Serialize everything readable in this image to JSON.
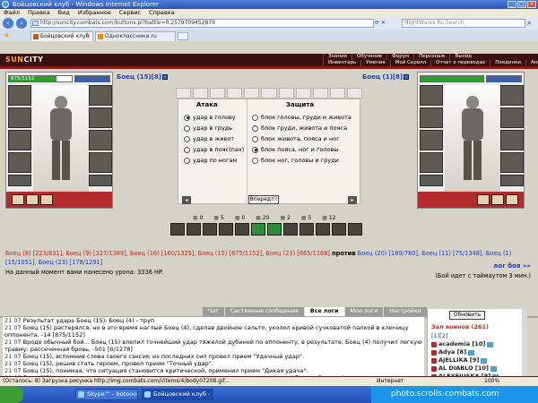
{
  "window": {
    "title": "Бойцовский клуб - Windows Internet Explorer",
    "controls": [
      "_",
      "□",
      "×"
    ]
  },
  "menu": [
    "Файл",
    "Правка",
    "Вид",
    "Избранное",
    "Сервис",
    "Справка"
  ],
  "address": {
    "url": "http://suncity.combats.com/buttons.pl?battle=0.2579709452879",
    "search": "NightWares.Ru.Search"
  },
  "tabs": [
    {
      "label": "Бойцовский клуб",
      "active": true
    },
    {
      "label": "Одноклассники.ru",
      "active": false
    }
  ],
  "game": {
    "logo_a": "SUN",
    "logo_b": "CITY",
    "nav_row1": [
      "Знания",
      "Обучение",
      "Форум",
      "Персонаж",
      "Выход"
    ],
    "nav_row2": [
      "Инвентарь",
      "Умения",
      "Мой Скролл",
      "Отчет о переводах",
      "Поединки",
      "Анкета"
    ],
    "left_fighter": {
      "name": "Боец",
      "level": "(15)",
      "clan": "[8]",
      "hp_text": "875/1152",
      "hp_fraction": 0.76
    },
    "right_fighter": {
      "name": "Боец",
      "level": "(1)",
      "clan": "[8]",
      "hp_fraction": 1.0
    },
    "attack_header": "Атака",
    "defense_header": "Защита",
    "attack_options": [
      {
        "label": "удар в голову",
        "selected": true
      },
      {
        "label": "удар в грудь",
        "selected": false
      },
      {
        "label": "удар в живот",
        "selected": false
      },
      {
        "label": "удар в пояс(пах)",
        "selected": false
      },
      {
        "label": "удар по ногам",
        "selected": false
      }
    ],
    "defense_options": [
      {
        "label": "блок головы, груди и живота",
        "selected": false
      },
      {
        "label": "блок груди, живота и пояса",
        "selected": false
      },
      {
        "label": "блок живота, пояса и ног",
        "selected": false
      },
      {
        "label": "блок пояса, ног и головы",
        "selected": true
      },
      {
        "label": "блок ног, головы и груди",
        "selected": false
      }
    ],
    "forward_button": "Вперед!!!",
    "stats": [
      "0",
      "5",
      "0",
      "20",
      "2",
      "5",
      "12"
    ],
    "team_left_text": "Боец (8) [223/831], Боец (9) [327/1389], Боец (16) [160/1325], Боец (15) [875/1152], Боец (23) [665/1268]",
    "versus": "против",
    "team_right_text": "Боец (20) [189/780], Боец (11) [75/1348], Боец (1) [15/1051], Боец (23) [178/1291]",
    "log_link": "лог боя »»",
    "damage_text": "На данный момент вами нанесено урона: 3336 HP.",
    "timeout_text": "(Бой идет с таймаутом 3 мин.)"
  },
  "chat": {
    "tabs": [
      "Чат",
      "Системные сообщения",
      "Все логи",
      "Мои логи",
      "Настройки"
    ],
    "active_tab": "Все логи",
    "log": [
      "21 07 Результат удара Боец (15): Боец (4) - труп",
      "21 07 Боец (15) растерялся, но в это время наглый Боец (4), сделав двойное сальто, уколол кривой сучковатой палкой в ключицу оппонента. -14 [875/1152]",
      "21 07 Вроде обычный бой... Боец (15) влепил точнейший удар тяжелой дубиной по оппоненту, в результате, Боец (4) получил легкую травму: рассеченная бровь. -501 [0/1278]",
      "21 07 Боец (15), вспомнив слова своего сэнсэя, из последних сил провел прием \"Удачный удар\".",
      "21 07 Боец (15), решив стать героем, провел прием \"Точный удар\".",
      "21 07 Боец (15), понимая, что ситуация становится критической, применил прием \"Дикая удача\".",
      "21 07 Боец (23), понял, пропустив очередной удар в голову, что поможет ему только прием \"Глухая Защита\".",
      "21 07 Боец (4), нетрезво оценив положение, решил, что поможет ему только прием \"Отменить\". +11 [98/1278]"
    ]
  },
  "players": {
    "refresh_label": "Обновить",
    "title": "Зал воинов (261)",
    "pages": "[1][2]",
    "list": [
      "academia [10]",
      "Adya [8]",
      "AJELLIKA [9]",
      "AL DIABLO [10]",
      "ALEXEIUSKA [8]",
      "ARKTIKA [8]"
    ]
  },
  "status": {
    "text": "(Осталось: 8) Загрузка рисунка http://img.combats.com/i/items/4/body07208.gif...",
    "zone": "Интернет",
    "zoom": "100%"
  },
  "taskbar": {
    "items": [
      "Skype™ - botooon",
      "Бойцовский клуб - ..."
    ],
    "watermark": "photo.scrolls.combats.com"
  }
}
